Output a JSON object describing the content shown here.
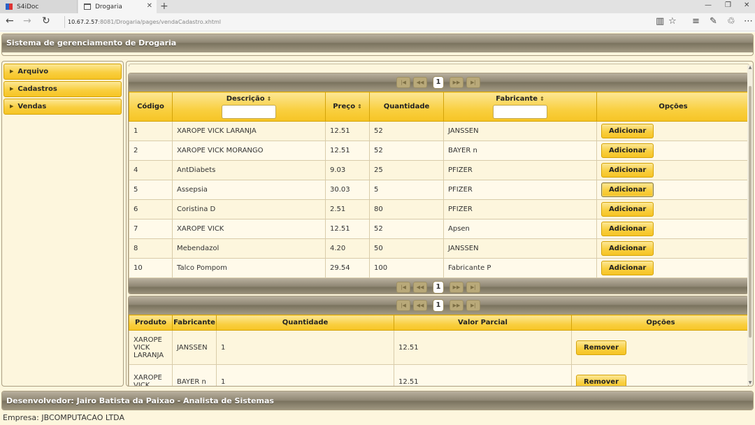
{
  "browser": {
    "tabs": [
      {
        "title": "S4iDoc",
        "active": false
      },
      {
        "title": "Drogaria",
        "active": true
      }
    ],
    "url_host": "10.67.2.57",
    "url_path": ":8081/Drogaria/pages/vendaCadastro.xhtml",
    "icons": [
      "back-arrow-icon",
      "forward-arrow-icon",
      "refresh-icon",
      "reading-view-icon",
      "favorite-star-icon",
      "hub-icon",
      "web-note-icon",
      "share-icon",
      "more-icon"
    ]
  },
  "header": {
    "title": "Sistema de gerenciamento de Drogaria"
  },
  "sidebar": {
    "items": [
      {
        "label": "Arquivo"
      },
      {
        "label": "Cadastros"
      },
      {
        "label": "Vendas"
      }
    ]
  },
  "pager": {
    "page": "1"
  },
  "products": {
    "columns": {
      "codigo": "Código",
      "descricao": "Descrição",
      "preco": "Preço",
      "quantidade": "Quantidade",
      "fabricante": "Fabricante",
      "opcoes": "Opções"
    },
    "action_label": "Adicionar",
    "rows": [
      {
        "codigo": "1",
        "descricao": "XAROPE VICK LARANJA",
        "preco": "12.51",
        "quantidade": "52",
        "fabricante": "JANSSEN"
      },
      {
        "codigo": "2",
        "descricao": "XAROPE VICK MORANGO",
        "preco": "12.51",
        "quantidade": "52",
        "fabricante": "BAYER n"
      },
      {
        "codigo": "4",
        "descricao": "AntDiabets",
        "preco": "9.03",
        "quantidade": "25",
        "fabricante": "PFIZER"
      },
      {
        "codigo": "5",
        "descricao": "Assepsia",
        "preco": "30.03",
        "quantidade": "5",
        "fabricante": "PFIZER"
      },
      {
        "codigo": "6",
        "descricao": "Coristina D",
        "preco": "2.51",
        "quantidade": "80",
        "fabricante": "PFIZER"
      },
      {
        "codigo": "7",
        "descricao": "XAROPE VICK",
        "preco": "12.51",
        "quantidade": "52",
        "fabricante": "Apsen"
      },
      {
        "codigo": "8",
        "descricao": "Mebendazol",
        "preco": "4.20",
        "quantidade": "50",
        "fabricante": "JANSSEN"
      },
      {
        "codigo": "10",
        "descricao": "Talco Pompom",
        "preco": "29.54",
        "quantidade": "100",
        "fabricante": "Fabricante P"
      }
    ]
  },
  "cart": {
    "columns": {
      "produto": "Produto",
      "fabricante": "Fabricante",
      "quantidade": "Quantidade",
      "valor": "Valor Parcial",
      "opcoes": "Opções"
    },
    "action_label": "Remover",
    "rows": [
      {
        "produto": "XAROPE VICK LARANJA",
        "fabricante": "JANSSEN",
        "quantidade": "1",
        "valor": "12.51"
      },
      {
        "produto": "XAROPE VICK",
        "fabricante": "BAYER n",
        "quantidade": "1",
        "valor": "12.51"
      }
    ]
  },
  "footer": {
    "developer": "Desenvolvedor: Jairo Batista da Paixao - Analista de Sistemas",
    "company": "Empresa: JBCOMPUTACAO LTDA"
  }
}
